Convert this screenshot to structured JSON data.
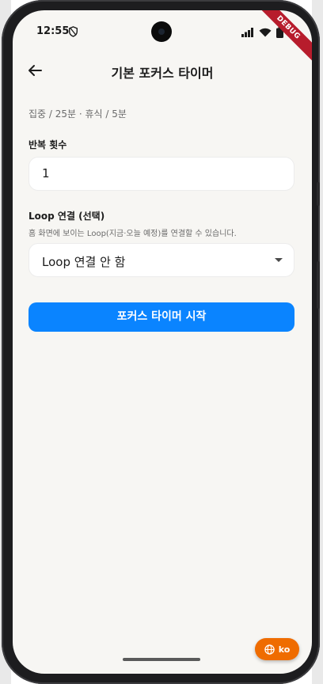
{
  "status_bar": {
    "time": "12:55"
  },
  "debug_banner": "DEBUG",
  "app_bar": {
    "title": "기본 포커스 타이머"
  },
  "subtitle": "집중 / 25분 · 휴식 / 5분",
  "repetitions": {
    "label": "반복 횟수",
    "value": "1"
  },
  "loop": {
    "label": "Loop 연결 (선택)",
    "helper": "홈 화면에 보이는 Loop(지금·오늘 예정)를 연결할 수 있습니다.",
    "selected": "Loop 연결 안 함"
  },
  "start_button": "포커스 타이머 시작",
  "language_button": "ko",
  "colors": {
    "primary": "#0a84ff",
    "language_fab": "#ef6c00",
    "debug_ribbon": "#b71c2c",
    "screen_background": "#f7f6f3"
  },
  "icons": {
    "back": "arrow-left-icon",
    "status": [
      "shield-icon",
      "signal-icon",
      "wifi-icon",
      "battery-icon"
    ],
    "dropdown": "caret-down-icon",
    "language": "globe-icon"
  }
}
